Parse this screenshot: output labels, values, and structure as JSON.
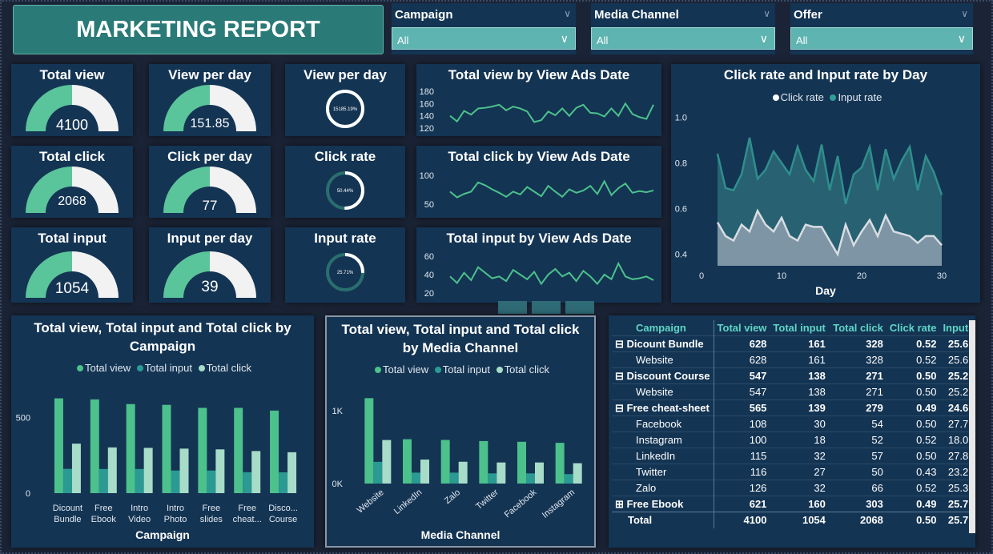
{
  "report": {
    "title": "MARKETING REPORT"
  },
  "slicers": [
    {
      "label": "Campaign",
      "value": "All"
    },
    {
      "label": "Media Channel",
      "value": "All"
    },
    {
      "label": "Offer",
      "value": "All"
    }
  ],
  "kpis": {
    "total_view": {
      "title": "Total view",
      "value": "4100",
      "fraction": 0.5
    },
    "view_per_day": {
      "title": "View per day",
      "value": "151.85",
      "fraction": 0.5
    },
    "total_click": {
      "title": "Total click",
      "value": "2068",
      "fraction": 0.5
    },
    "click_per_day": {
      "title": "Click per day",
      "value": "77",
      "fraction": 0.5
    },
    "total_input": {
      "title": "Total input",
      "value": "1054",
      "fraction": 0.5
    },
    "input_per_day": {
      "title": "Input per day",
      "value": "39",
      "fraction": 0.5
    },
    "view_per_day_ring": {
      "title": "View per day",
      "value": "15185.19%",
      "fraction": 1.0
    },
    "click_rate_ring": {
      "title": "Click rate",
      "value": "50.44%",
      "fraction": 0.5044
    },
    "input_rate_ring": {
      "title": "Input rate",
      "value": "25.71%",
      "fraction": 0.2571
    }
  },
  "chart_data": [
    {
      "type": "line",
      "title": "Total view by View Ads Date",
      "y_ticks": [
        "180",
        "160",
        "140",
        "120"
      ],
      "ylim": [
        115,
        185
      ],
      "series": [
        {
          "values": [
            140,
            131,
            148,
            142,
            152,
            153,
            155,
            158,
            149,
            155,
            152,
            147,
            130,
            133,
            147,
            141,
            152,
            140,
            153,
            158,
            145,
            144,
            139,
            152,
            140,
            160,
            143,
            138,
            135,
            158
          ]
        }
      ]
    },
    {
      "type": "line",
      "title": "Total click by View Ads Date",
      "y_ticks": [
        "100",
        "50"
      ],
      "ylim": [
        35,
        110
      ],
      "series": [
        {
          "values": [
            72,
            62,
            68,
            72,
            88,
            83,
            76,
            70,
            63,
            72,
            67,
            80,
            72,
            64,
            82,
            72,
            63,
            76,
            70,
            74,
            82,
            68,
            90,
            66,
            78,
            86,
            70,
            73,
            71,
            74
          ]
        }
      ]
    },
    {
      "type": "line",
      "title": "Total input by View Ads Date",
      "y_ticks": [
        "60",
        "40",
        "20"
      ],
      "ylim": [
        15,
        65
      ],
      "series": [
        {
          "values": [
            38,
            31,
            42,
            34,
            48,
            42,
            36,
            38,
            33,
            45,
            40,
            35,
            43,
            30,
            40,
            46,
            38,
            42,
            33,
            44,
            38,
            30,
            40,
            35,
            52,
            38,
            35,
            36,
            38,
            34
          ]
        }
      ]
    },
    {
      "type": "area",
      "title": "Click rate and Input rate by Day",
      "xlabel": "Day",
      "x_ticks": [
        "0",
        "10",
        "20",
        "30"
      ],
      "y_ticks": [
        "1.0",
        "0.8",
        "0.6",
        "0.4"
      ],
      "xlim": [
        0,
        30
      ],
      "ylim": [
        0.35,
        1.05
      ],
      "series": [
        {
          "name": "Click rate",
          "color": "#d8dde3",
          "values": [
            0.54,
            0.48,
            0.46,
            0.53,
            0.5,
            0.59,
            0.53,
            0.5,
            0.56,
            0.48,
            0.46,
            0.53,
            0.52,
            0.52,
            0.46,
            0.4,
            0.53,
            0.44,
            0.5,
            0.55,
            0.48,
            0.57,
            0.5,
            0.49,
            0.48,
            0.45,
            0.48,
            0.48,
            0.44
          ]
        },
        {
          "name": "Input rate",
          "color": "#2f8f8c",
          "values": [
            0.84,
            0.69,
            0.68,
            0.75,
            0.91,
            0.73,
            0.77,
            0.85,
            0.8,
            0.75,
            0.87,
            0.77,
            0.72,
            0.88,
            0.68,
            0.83,
            0.62,
            0.75,
            0.78,
            0.87,
            0.68,
            0.86,
            0.73,
            0.81,
            0.87,
            0.68,
            0.83,
            0.76,
            0.66
          ]
        }
      ]
    },
    {
      "type": "bar",
      "title": "Total view, Total input and Total click by Campaign",
      "xlabel": "Campaign",
      "y_ticks": [
        "500",
        "0"
      ],
      "ylim": [
        0,
        700
      ],
      "categories": [
        "Dicount Bundle",
        "Free Ebook",
        "Intro Video",
        "Intro Photo",
        "Free slides",
        "Free cheat...",
        "Disco... Course"
      ],
      "series": [
        {
          "name": "Total view",
          "color": "#4cc18c",
          "values": [
            628,
            621,
            590,
            585,
            565,
            565,
            547
          ]
        },
        {
          "name": "Total input",
          "color": "#2b9a93",
          "values": [
            161,
            160,
            160,
            150,
            150,
            139,
            138
          ]
        },
        {
          "name": "Total click",
          "color": "#a7dcc9",
          "values": [
            328,
            303,
            300,
            295,
            290,
            279,
            271
          ]
        }
      ]
    },
    {
      "type": "bar",
      "title": "Total view, Total input and Total click by Media Channel",
      "xlabel": "Media Channel",
      "y_ticks": [
        "1K",
        "0K"
      ],
      "ylim": [
        0,
        1300
      ],
      "categories": [
        "Website",
        "LinkedIn",
        "Zalo",
        "Twitter",
        "Facebook",
        "Instagram"
      ],
      "series": [
        {
          "name": "Total view",
          "color": "#4cc18c",
          "values": [
            1175,
            610,
            600,
            585,
            575,
            560
          ]
        },
        {
          "name": "Total input",
          "color": "#2b9a93",
          "values": [
            299,
            150,
            150,
            140,
            140,
            130
          ]
        },
        {
          "name": "Total click",
          "color": "#a7dcc9",
          "values": [
            599,
            330,
            300,
            290,
            290,
            280
          ]
        }
      ]
    }
  ],
  "matrix": {
    "headers": [
      "Campaign",
      "Total view",
      "Total input",
      "Total click",
      "Click rate",
      "Input"
    ],
    "rows": [
      {
        "kind": "group",
        "expander": "⊟",
        "name": "Dicount Bundle",
        "view": "628",
        "input": "161",
        "click": "328",
        "rate": "0.52",
        "irate": "25.6"
      },
      {
        "kind": "child",
        "expander": "",
        "name": "Website",
        "view": "628",
        "input": "161",
        "click": "328",
        "rate": "0.52",
        "irate": "25.6"
      },
      {
        "kind": "group",
        "expander": "⊟",
        "name": "Discount Course",
        "view": "547",
        "input": "138",
        "click": "271",
        "rate": "0.50",
        "irate": "25.2"
      },
      {
        "kind": "child",
        "expander": "",
        "name": "Website",
        "view": "547",
        "input": "138",
        "click": "271",
        "rate": "0.50",
        "irate": "25.2"
      },
      {
        "kind": "group",
        "expander": "⊟",
        "name": "Free cheat-sheet",
        "view": "565",
        "input": "139",
        "click": "279",
        "rate": "0.49",
        "irate": "24.6"
      },
      {
        "kind": "child",
        "expander": "",
        "name": "Facebook",
        "view": "108",
        "input": "30",
        "click": "54",
        "rate": "0.50",
        "irate": "27.7"
      },
      {
        "kind": "child",
        "expander": "",
        "name": "Instagram",
        "view": "100",
        "input": "18",
        "click": "52",
        "rate": "0.52",
        "irate": "18.0"
      },
      {
        "kind": "child",
        "expander": "",
        "name": "LinkedIn",
        "view": "115",
        "input": "32",
        "click": "57",
        "rate": "0.50",
        "irate": "27.8"
      },
      {
        "kind": "child",
        "expander": "",
        "name": "Twitter",
        "view": "116",
        "input": "27",
        "click": "50",
        "rate": "0.43",
        "irate": "23.2"
      },
      {
        "kind": "child",
        "expander": "",
        "name": "Zalo",
        "view": "126",
        "input": "32",
        "click": "66",
        "rate": "0.52",
        "irate": "25.3"
      },
      {
        "kind": "group",
        "expander": "⊞",
        "name": "Free Ebook",
        "view": "621",
        "input": "160",
        "click": "303",
        "rate": "0.49",
        "irate": "25.7"
      },
      {
        "kind": "total",
        "expander": "",
        "name": "Total",
        "view": "4100",
        "input": "1054",
        "click": "2068",
        "rate": "0.50",
        "irate": "25.7"
      }
    ]
  },
  "colors": {
    "tile_bg": "#143453",
    "gauge_fill": "#5ac49a",
    "gauge_track": "#f2f2f2",
    "accent": "#5ed6c6"
  }
}
